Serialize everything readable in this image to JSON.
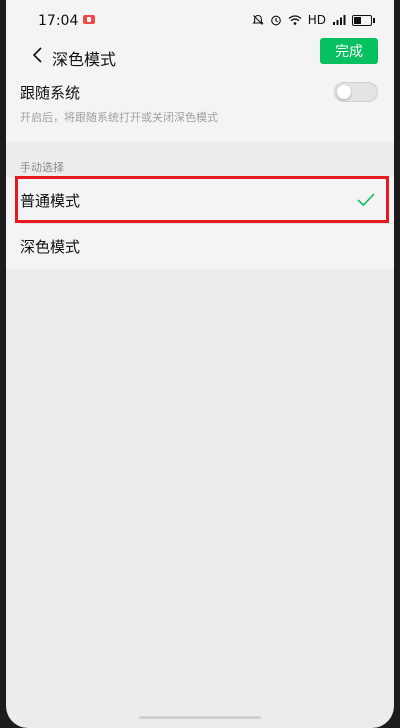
{
  "status_bar": {
    "time": "17:04",
    "network_label": "HD",
    "icons": [
      "recording-badge-icon",
      "alarm-icon",
      "clock-icon",
      "wifi-icon",
      "signal-icon",
      "battery-icon"
    ]
  },
  "nav": {
    "title": "深色模式",
    "back_icon": "chevron-left-icon",
    "done_label": "完成",
    "done_color": "#07c160"
  },
  "follow_system": {
    "title": "跟随系统",
    "description": "开启后，将跟随系统打开或关闭深色模式",
    "enabled": false
  },
  "manual": {
    "section_label": "手动选择",
    "options": [
      {
        "label": "普通模式",
        "selected": true
      },
      {
        "label": "深色模式",
        "selected": false
      }
    ],
    "highlight_color": "#e8191e",
    "check_color": "#07c160"
  }
}
